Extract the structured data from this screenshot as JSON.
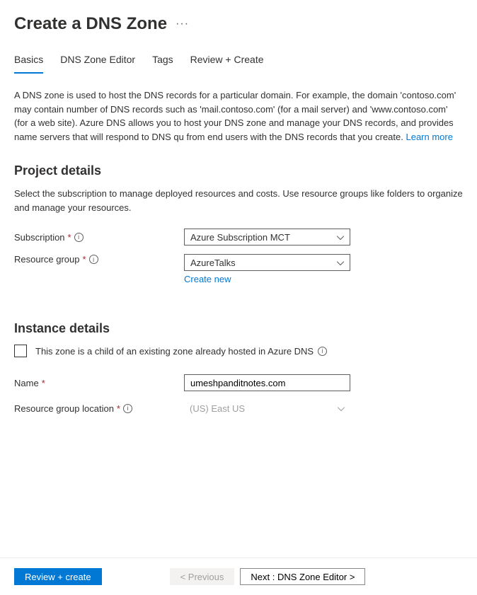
{
  "header": {
    "title": "Create a DNS Zone"
  },
  "tabs": [
    {
      "label": "Basics",
      "active": true
    },
    {
      "label": "DNS Zone Editor",
      "active": false
    },
    {
      "label": "Tags",
      "active": false
    },
    {
      "label": "Review + Create",
      "active": false
    }
  ],
  "description": {
    "text": "A DNS zone is used to host the DNS records for a particular domain. For example, the domain 'contoso.com' may contain number of DNS records such as 'mail.contoso.com' (for a mail server) and 'www.contoso.com' (for a web site). Azure DNS allows you to host your DNS zone and manage your DNS records, and provides name servers that will respond to DNS qu from end users with the DNS records that you create.",
    "learn_more": "Learn more"
  },
  "project_details": {
    "title": "Project details",
    "description": "Select the subscription to manage deployed resources and costs. Use resource groups like folders to organize and manage your resources.",
    "subscription_label": "Subscription",
    "subscription_value": "Azure Subscription MCT",
    "resource_group_label": "Resource group",
    "resource_group_value": "AzureTalks",
    "create_new": "Create new"
  },
  "instance_details": {
    "title": "Instance details",
    "child_zone_label": "This zone is a child of an existing zone already hosted in Azure DNS",
    "name_label": "Name",
    "name_value": "umeshpanditnotes.com",
    "location_label": "Resource group location",
    "location_value": "(US) East US"
  },
  "footer": {
    "review_create": "Review + create",
    "previous": "< Previous",
    "next": "Next : DNS Zone Editor >"
  }
}
